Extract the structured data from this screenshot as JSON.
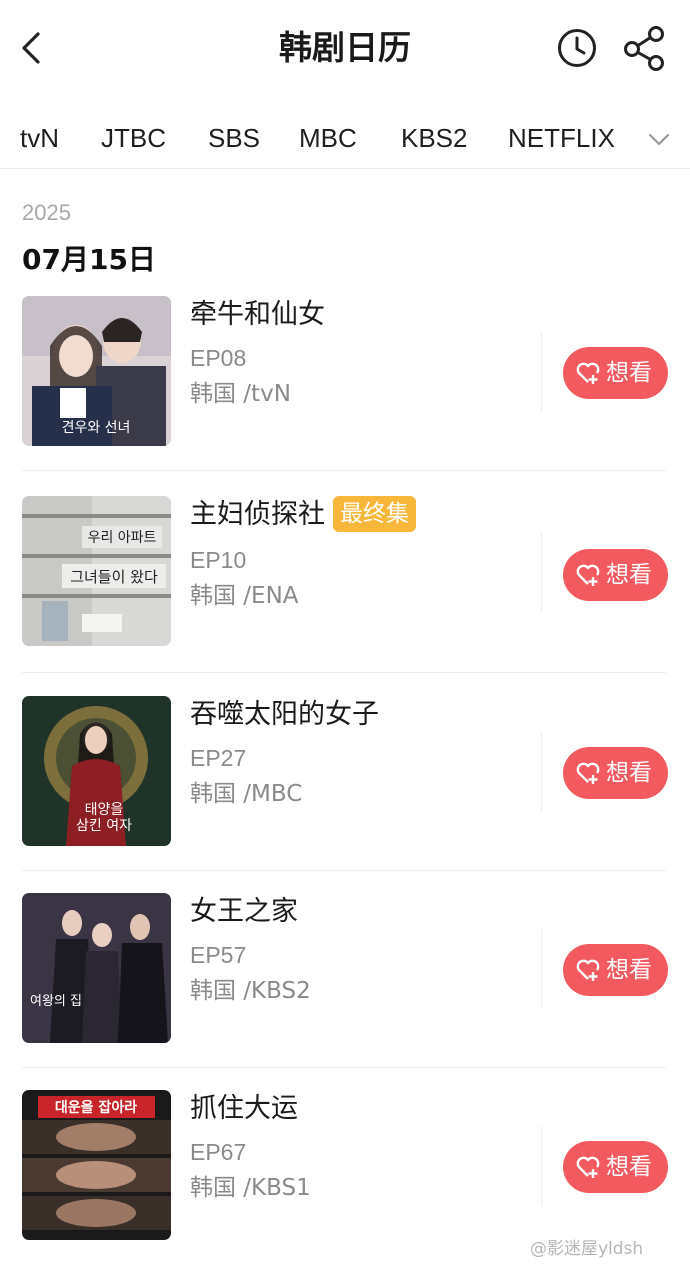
{
  "header": {
    "title": "韩剧日历",
    "back_icon": "chevron-left-icon",
    "history_icon": "clock-icon",
    "share_icon": "share-icon"
  },
  "tabs": [
    {
      "label": "tvN"
    },
    {
      "label": "JTBC"
    },
    {
      "label": "SBS"
    },
    {
      "label": "MBC"
    },
    {
      "label": "KBS2"
    },
    {
      "label": "NETFLIX"
    }
  ],
  "tabs_more_icon": "chevron-down-icon",
  "date_section": {
    "year": "2025",
    "date": "07月15日"
  },
  "shows": [
    {
      "title": "牵牛和仙女",
      "badge": "",
      "episode": "EP08",
      "meta": "韩国 /tvN",
      "want_label": "想看"
    },
    {
      "title": "主妇侦探社",
      "badge": "最终集",
      "episode": "EP10",
      "meta": "韩国 /ENA",
      "want_label": "想看"
    },
    {
      "title": "吞噬太阳的女子",
      "badge": "",
      "episode": "EP27",
      "meta": "韩国 /MBC",
      "want_label": "想看"
    },
    {
      "title": "女王之家",
      "badge": "",
      "episode": "EP57",
      "meta": "韩国 /KBS2",
      "want_label": "想看"
    },
    {
      "title": "抓住大运",
      "badge": "",
      "episode": "EP67",
      "meta": "韩国 /KBS1",
      "want_label": "想看"
    }
  ],
  "colors": {
    "want_button": "#f25a5f",
    "finale_badge": "#f7b73a"
  },
  "watermark": "@影迷屋yldsh"
}
